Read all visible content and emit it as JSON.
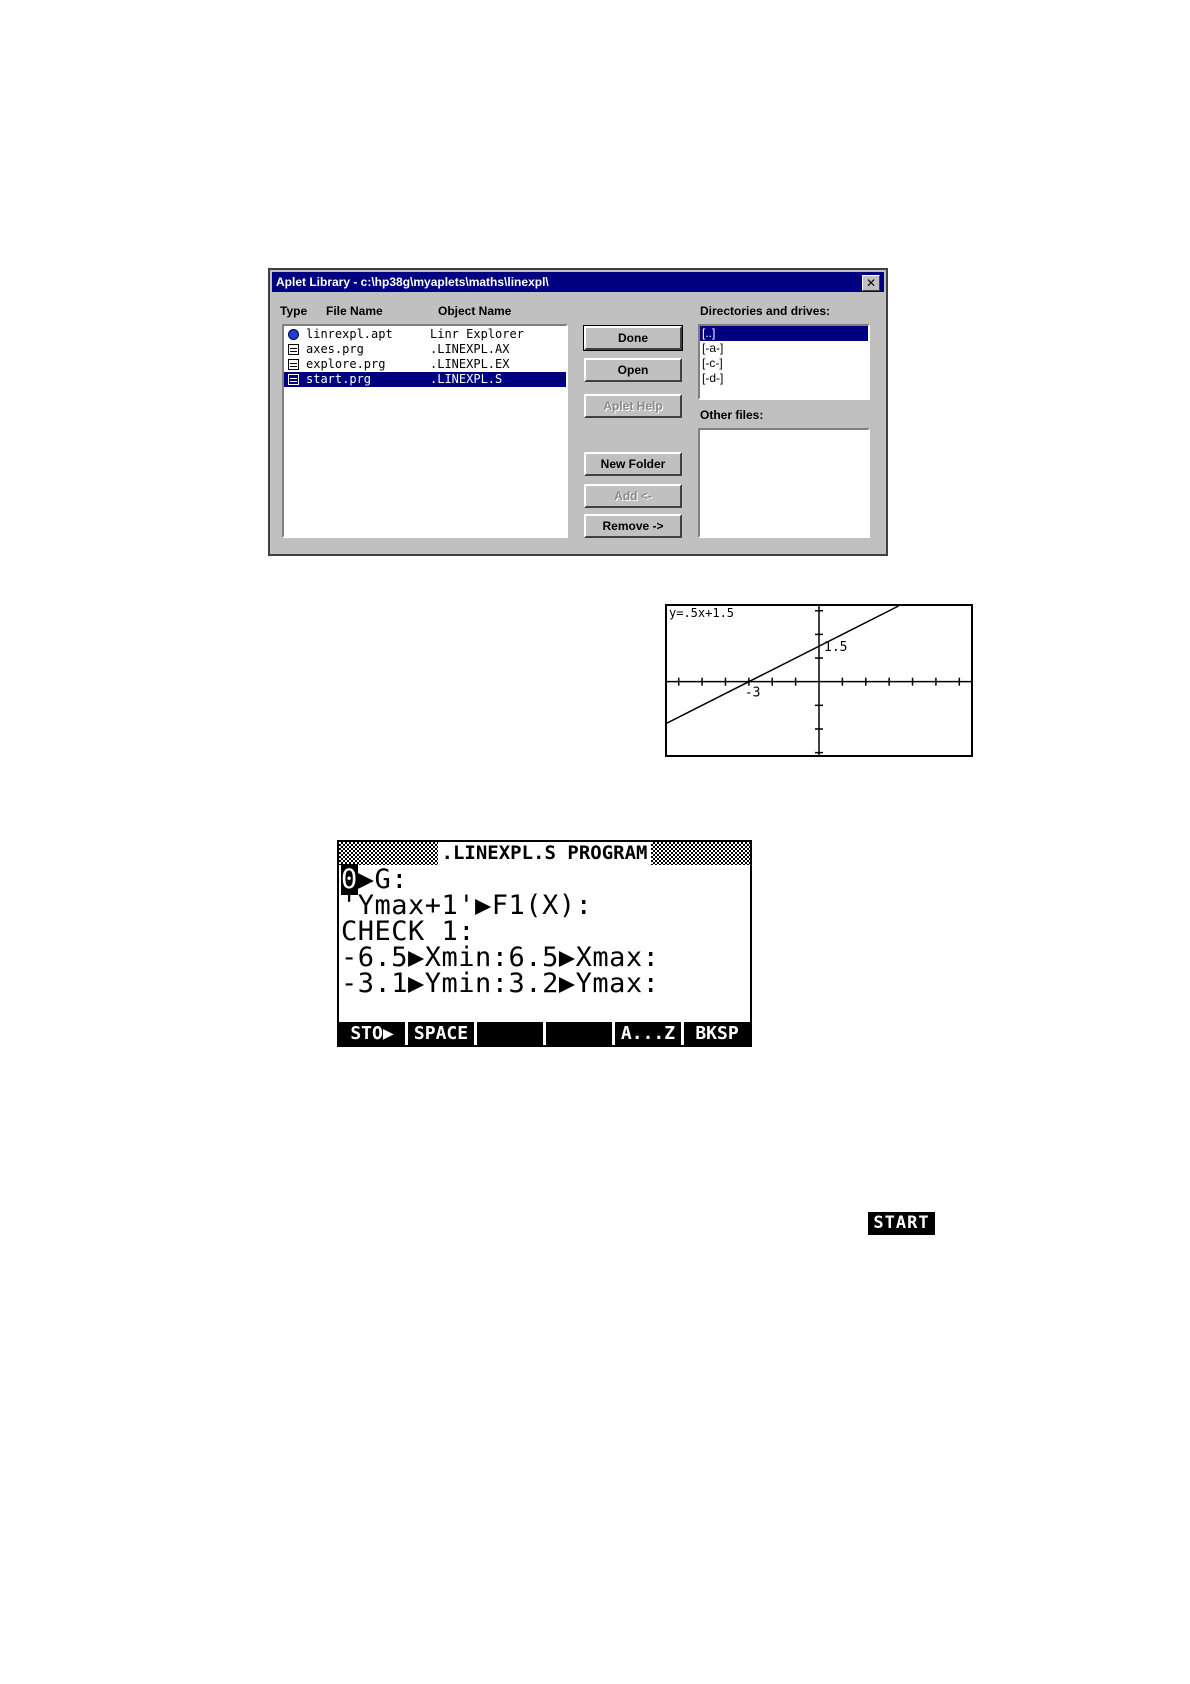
{
  "dialog": {
    "title": "Aplet Library - c:\\hp38g\\myaplets\\maths\\linexpl\\",
    "close": "✕",
    "headers": {
      "type": "Type",
      "file_name": "File Name",
      "object_name": "Object Name"
    },
    "files": [
      {
        "icon": "aplet-icon",
        "file": "linrexpl.apt",
        "object": "Linr Explorer",
        "selected": false
      },
      {
        "icon": "program-icon",
        "file": "axes.prg",
        "object": ".LINEXPL.AX",
        "selected": false
      },
      {
        "icon": "program-icon",
        "file": "explore.prg",
        "object": ".LINEXPL.EX",
        "selected": false
      },
      {
        "icon": "program-icon",
        "file": "start.prg",
        "object": ".LINEXPL.S",
        "selected": true
      }
    ],
    "buttons": {
      "done": "Done",
      "open": "Open",
      "aplet_help": "Aplet Help",
      "new_folder": "New Folder",
      "add": "Add <-",
      "remove": "Remove ->"
    },
    "directories_label": "Directories and drives:",
    "directories": [
      {
        "label": "[..]",
        "selected": true
      },
      {
        "label": "[-a-]",
        "selected": false
      },
      {
        "label": "[-c-]",
        "selected": false
      },
      {
        "label": "[-d-]",
        "selected": false
      }
    ],
    "other_files_label": "Other files:"
  },
  "graph": {
    "function_label": "y=.5x+1.5",
    "y_intercept_label": "1.5",
    "x_intercept_label": "-3",
    "xlim": [
      -6.5,
      6.5
    ],
    "ylim": [
      -3.1,
      3.2
    ],
    "slope": 0.5,
    "intercept": 1.5
  },
  "program": {
    "title": ".LINEXPL.S PROGRAM",
    "lines": [
      "0▶G:",
      "'Ymax+1'▶F1(X):",
      "CHECK 1:",
      "-6.5▶Xmin:6.5▶Xmax:",
      "-3.1▶Ymin:3.2▶Ymax:"
    ],
    "softkeys": [
      "STO▶",
      "SPACE",
      "",
      "",
      "A...Z",
      "BKSP"
    ]
  },
  "start_key": "START"
}
